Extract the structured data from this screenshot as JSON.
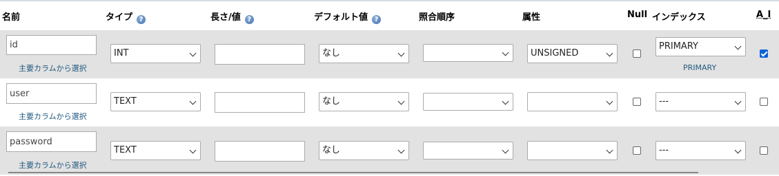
{
  "headers": {
    "name": "名前",
    "type": "タイプ",
    "length": "長さ/値",
    "default": "デフォルト値",
    "collation": "照合順序",
    "attributes": "属性",
    "null": "Null",
    "index": "インデックス",
    "ai": "A_I"
  },
  "help_glyph": "?",
  "rows": [
    {
      "name": "id",
      "pick_link": "主要カラムから選択",
      "type": "INT",
      "length": "",
      "default": "なし",
      "collation": "",
      "attribute": "UNSIGNED",
      "null_checked": false,
      "index": "PRIMARY",
      "index_link": "PRIMARY",
      "ai_checked": true
    },
    {
      "name": "user",
      "pick_link": "主要カラムから選択",
      "type": "TEXT",
      "length": "",
      "default": "なし",
      "collation": "",
      "attribute": "",
      "null_checked": false,
      "index": "---",
      "ai_checked": false
    },
    {
      "name": "password",
      "pick_link": "主要カラムから選択",
      "type": "TEXT",
      "length": "",
      "default": "なし",
      "collation": "",
      "attribute": "",
      "null_checked": false,
      "index": "---",
      "ai_checked": false
    }
  ],
  "colors": {
    "row_grey": "#e2e2e2",
    "link": "#235a81",
    "checked": "#0b63d6"
  }
}
